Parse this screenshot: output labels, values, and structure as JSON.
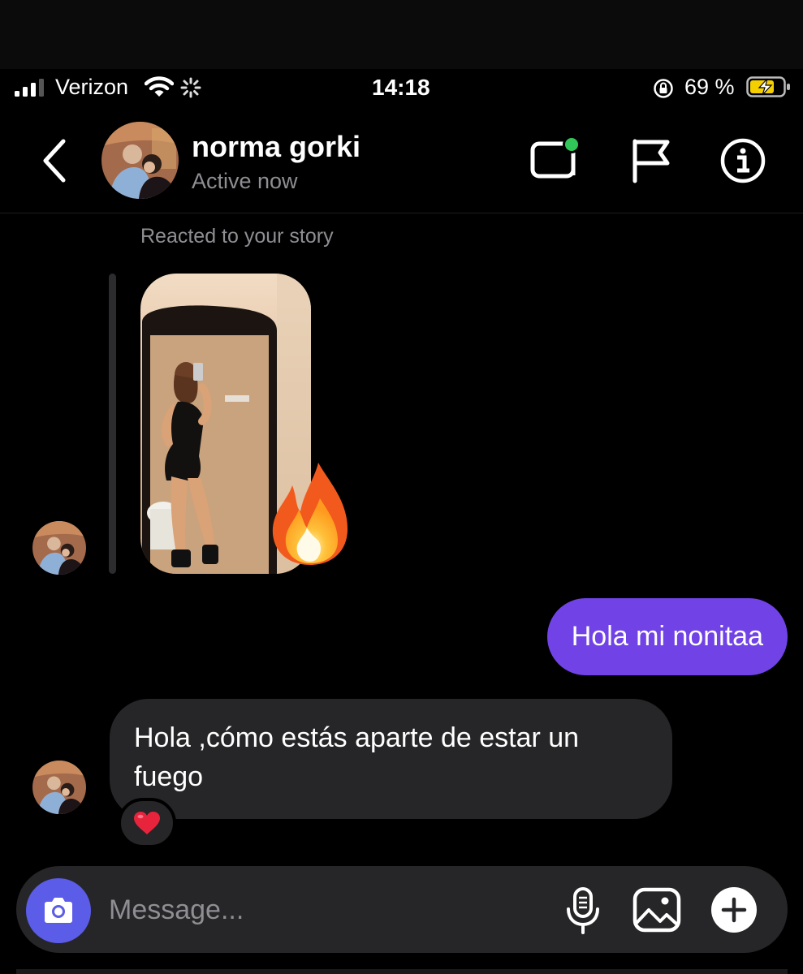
{
  "status_bar": {
    "carrier": "Verizon",
    "time": "14:18",
    "battery_percent": "69 %"
  },
  "header": {
    "contact_name": "norma gorki",
    "contact_status": "Active now",
    "video_call_online": true
  },
  "conversation": {
    "story_caption": "Reacted to your story",
    "story_reaction_icon": "fire-emoji",
    "messages": [
      {
        "direction": "outgoing",
        "text": "Hola mi nonitaa"
      },
      {
        "direction": "incoming",
        "text": "Hola ,cómo estás aparte de estar un fuego",
        "reaction": "heart-emoji"
      }
    ]
  },
  "composer": {
    "placeholder": "Message..."
  },
  "colors": {
    "background": "#000000",
    "outgoing_bubble": "#7143e6",
    "incoming_bubble": "#262628",
    "camera_button": "#5b5ce8",
    "online_dot": "#30c758",
    "muted_text": "#8e8e93"
  }
}
